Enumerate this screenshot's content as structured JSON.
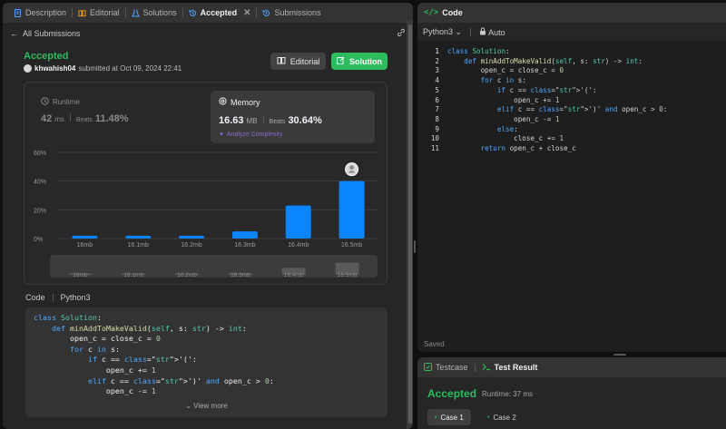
{
  "left_tabs": [
    {
      "label": "Description",
      "icon": "description-icon"
    },
    {
      "label": "Editorial",
      "icon": "book-icon"
    },
    {
      "label": "Solutions",
      "icon": "flask-icon"
    },
    {
      "label": "Accepted",
      "icon": "history-icon",
      "active": true
    },
    {
      "label": "Submissions",
      "icon": "history-icon"
    }
  ],
  "subheader": {
    "back_label": "All Submissions"
  },
  "submission": {
    "status": "Accepted",
    "username": "khwahish04",
    "submitted_text": "submitted at Oct 09, 2024 22:41",
    "editorial_button": "Editorial",
    "solution_button": "Solution"
  },
  "runtime": {
    "label": "Runtime",
    "value": "42",
    "unit": "ms",
    "beats_label": "Beats",
    "beats_value": "11.48%"
  },
  "memory": {
    "label": "Memory",
    "value": "16.63",
    "unit": "MB",
    "beats_label": "Beats",
    "beats_value": "30.64%",
    "analyze_label": "Analyze Complexity"
  },
  "chart_data": {
    "type": "bar",
    "categories": [
      "16mb",
      "16.1mb",
      "16.2mb",
      "16.3mb",
      "16.4mb",
      "16.5mb"
    ],
    "values": [
      2,
      2,
      2,
      5,
      23,
      40
    ],
    "ylim": [
      0,
      60
    ],
    "yticks": [
      "60%",
      "40%",
      "20%",
      "0%"
    ],
    "ytick_values": [
      60,
      40,
      20,
      0
    ],
    "highlight_index": 5,
    "grid": true,
    "bar_color": "#0a84ff",
    "overview_values": [
      2,
      2,
      2,
      5,
      23,
      40
    ]
  },
  "code_section": {
    "label": "Code",
    "language": "Python3",
    "view_more": "View more"
  },
  "code_preview": [
    "class Solution:",
    "    def minAddToMakeValid(self, s: str) -> int:",
    "        open_c = close_c = 0",
    "        for c in s:",
    "            if c == '(':",
    "                open_c += 1",
    "            elif c == ')' and open_c > 0:",
    "                open_c -= 1"
  ],
  "editor": {
    "title": "Code",
    "language": "Python3",
    "mode": "Auto",
    "saved_label": "Saved",
    "current_line": 1,
    "lines": [
      "class Solution:",
      "    def minAddToMakeValid(self, s: str) -> int:",
      "        open_c = close_c = 0",
      "        for c in s:",
      "            if c == '(':",
      "                open_c += 1",
      "            elif c == ')' and open_c > 0:",
      "                open_c -= 1",
      "            else:",
      "                close_c += 1",
      "        return open_c + close_c"
    ]
  },
  "result_panel": {
    "testcase_tab": "Testcase",
    "result_tab": "Test Result",
    "status": "Accepted",
    "runtime_text": "Runtime: 37 ms",
    "cases": [
      "Case 1",
      "Case 2"
    ]
  },
  "colors": {
    "accepted": "#2cbb5d",
    "bar": "#0a84ff",
    "accent_purple": "#8a6bd1"
  }
}
